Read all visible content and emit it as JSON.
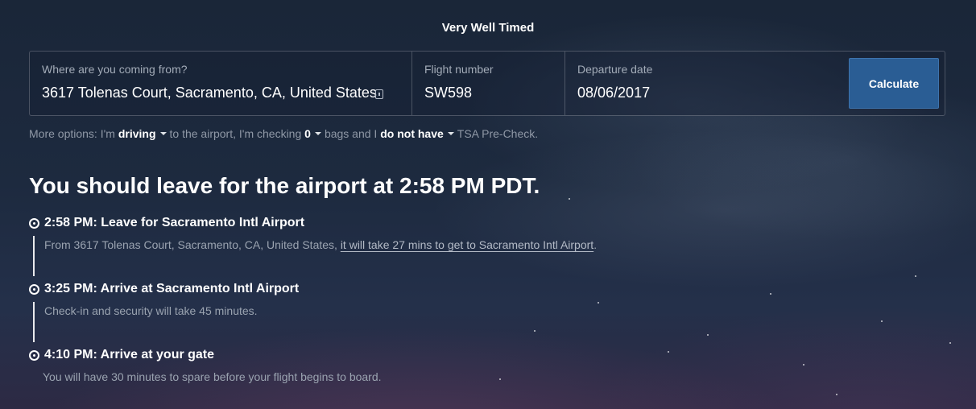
{
  "app": {
    "title": "Very Well Timed"
  },
  "form": {
    "origin": {
      "label": "Where are you coming from?",
      "value": "3617 Tolenas Court, Sacramento, CA, United States"
    },
    "flight": {
      "label": "Flight number",
      "value": "SW598"
    },
    "date": {
      "label": "Departure date",
      "value": "08/06/2017"
    },
    "calculate_label": "Calculate"
  },
  "options": {
    "prefix": "More options: I'm",
    "transport": "driving",
    "middle1": "to the airport, I'm checking",
    "bags": "0",
    "middle2": "bags and I",
    "precheck": "do not have",
    "suffix": "TSA Pre-Check."
  },
  "result": {
    "headline": "You should leave for the airport at 2:58 PM PDT.",
    "steps": [
      {
        "title": "2:58 PM: Leave for Sacramento Intl Airport",
        "desc_prefix": "From 3617 Tolenas Court, Sacramento, CA, United States,",
        "desc_link": "it will take 27 mins to get to Sacramento Intl Airport",
        "desc_suffix": "."
      },
      {
        "title": "3:25 PM: Arrive at Sacramento Intl Airport",
        "desc": "Check-in and security will take 45 minutes."
      },
      {
        "title": "4:10 PM: Arrive at your gate",
        "desc": "You will have 30 minutes to spare before your flight begins to board."
      }
    ]
  },
  "icons": {
    "step_marker": "clock-icon",
    "dropdown": "caret-down-icon",
    "field_badge": "location-icon"
  },
  "colors": {
    "accent_button": "#2a5d94",
    "muted_text": "#8f98a6",
    "background": "#1d2a3f"
  }
}
